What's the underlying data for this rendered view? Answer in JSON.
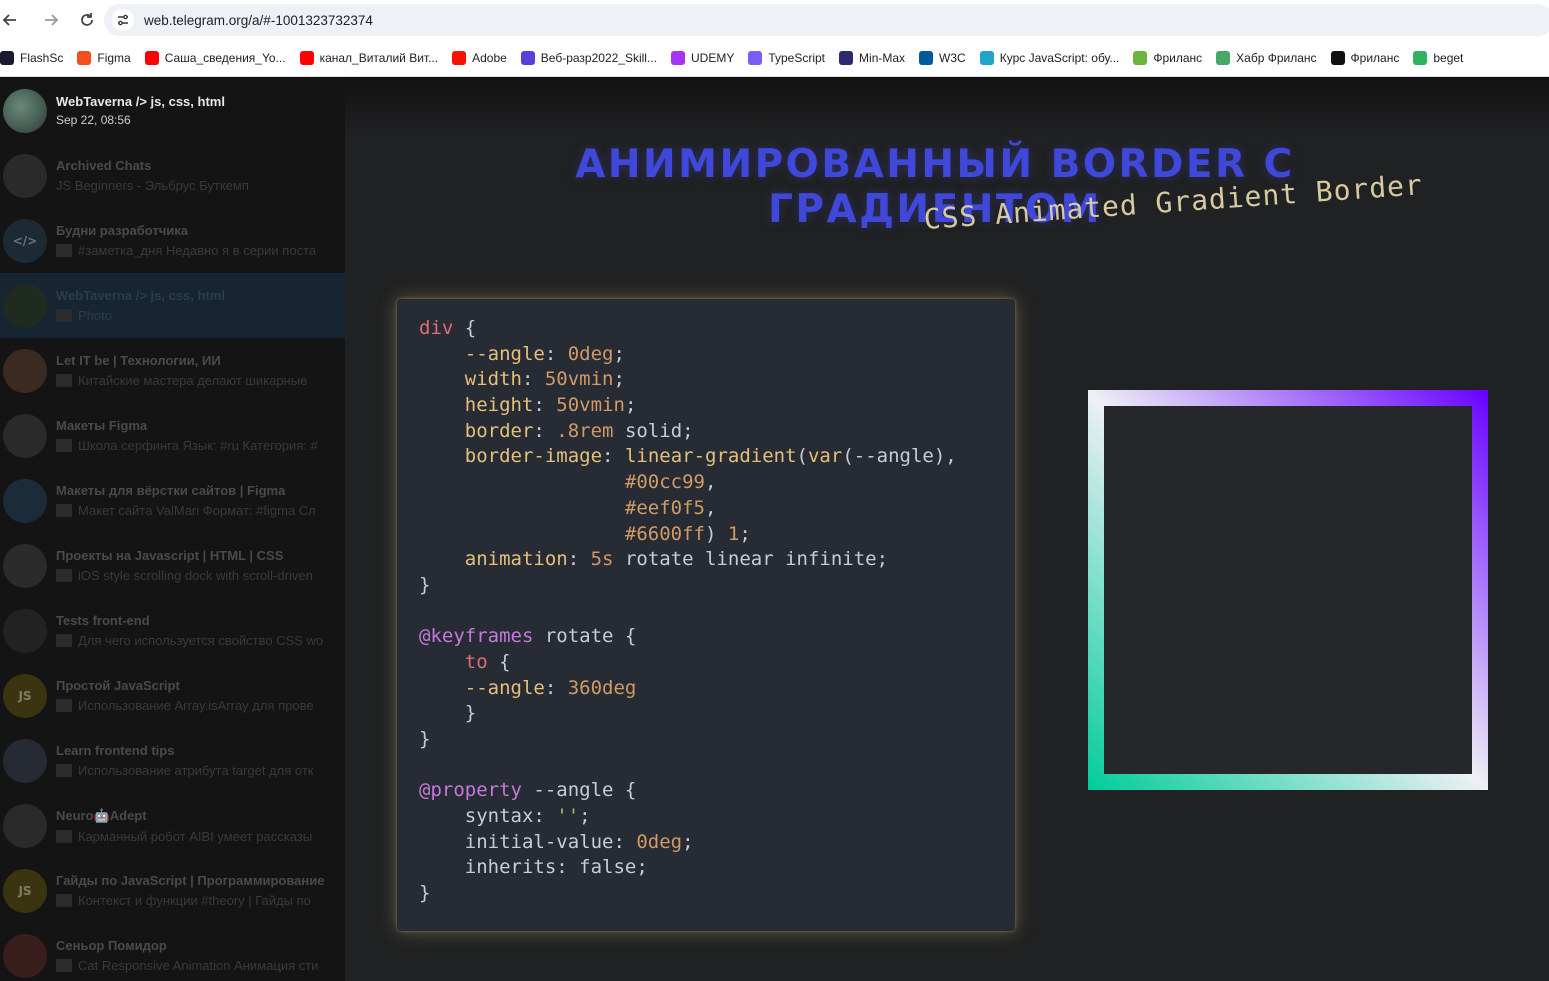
{
  "browser": {
    "url": "web.telegram.org/a/#-1001323732374"
  },
  "bookmarks": [
    {
      "label": "FlashSc",
      "icon": "flashcard-icon",
      "color": "#1a1a2e"
    },
    {
      "label": "Figma",
      "icon": "figma-icon",
      "color": "#f24e1e"
    },
    {
      "label": "Саша_сведения_Yo...",
      "icon": "youtube-icon",
      "color": "#ff0000"
    },
    {
      "label": "канал_Виталий Вит...",
      "icon": "youtube-icon",
      "color": "#ff0000"
    },
    {
      "label": "Adobe",
      "icon": "adobe-icon",
      "color": "#fa0f00"
    },
    {
      "label": "Веб-разр2022_Skill...",
      "icon": "skillbox-icon",
      "color": "#5b3fd9"
    },
    {
      "label": "UDEMY",
      "icon": "udemy-icon",
      "color": "#a435f0"
    },
    {
      "label": "TypeScript",
      "icon": "typescript-icon",
      "color": "#7b5cf5"
    },
    {
      "label": "Min-Max",
      "icon": "minmax-icon",
      "color": "#2d2a6e"
    },
    {
      "label": "W3C",
      "icon": "w3c-icon",
      "color": "#005a9c"
    },
    {
      "label": "Курс JavaScript: обу...",
      "icon": "course-icon",
      "color": "#1ea5c7"
    },
    {
      "label": "Фриланс",
      "icon": "freelance-icon",
      "color": "#6cb33f"
    },
    {
      "label": "Хабр Фриланс",
      "icon": "habr-icon",
      "color": "#48a868"
    },
    {
      "label": "Фриланс",
      "icon": "kwork-icon",
      "color": "#111111"
    },
    {
      "label": "beget",
      "icon": "beget-icon",
      "color": "#2fb35c"
    }
  ],
  "media_header": {
    "chat_name": "WebTaverna /> js, css, html",
    "date": "Sep 22, 08:56"
  },
  "chats": [
    {
      "name": "Archived Chats",
      "preview": "JS Beginners - Эльбрус Буткемп",
      "avatar_color": "#2a2a2a",
      "avatar_text": ""
    },
    {
      "name": "Будни разработчика",
      "preview": "#заметка_дня Недавно я в серии поста",
      "avatar_color": "#1c2a35",
      "avatar_text": "</>"
    },
    {
      "name": "WebTaverna /> js, css, html",
      "preview": "Photo",
      "avatar_color": "#1f2a20",
      "avatar_text": ""
    },
    {
      "name": "Let IT be | Технологии, ИИ",
      "preview": "Китайские мастера делают шикарные",
      "avatar_color": "#3a2a22",
      "avatar_text": ""
    },
    {
      "name": "Макеты Figma",
      "preview": "Школа серфинга Язык: #ru Категория: #",
      "avatar_color": "#2a2a2a",
      "avatar_text": ""
    },
    {
      "name": "Макеты для вёрстки сайтов | Figma",
      "preview": "Макет сайта ValMari Формат: #figma Сл",
      "avatar_color": "#1c2b3a",
      "avatar_text": ""
    },
    {
      "name": "Проекты на Javascript | HTML | CSS",
      "preview": "iOS style scrolling dock with scroll-driven",
      "avatar_color": "#2b2b2b",
      "avatar_text": ""
    },
    {
      "name": "Tests front-end",
      "preview": "Для чего используется свойство CSS wo",
      "avatar_color": "#222222",
      "avatar_text": ""
    },
    {
      "name": "Простой JavaScript",
      "preview": "Использование Array.isArray для прове",
      "avatar_color": "#3a3410",
      "avatar_text": "JS"
    },
    {
      "name": "Learn frontend tips",
      "preview": "Использование атрибута target для отк",
      "avatar_color": "#262a33",
      "avatar_text": ""
    },
    {
      "name": "Neuro🤖Adept",
      "preview": "Карманный робот AIBI умеет рассказы",
      "avatar_color": "#2a2a2a",
      "avatar_text": ""
    },
    {
      "name": "Гайды по JavaScript | Программирование",
      "preview": "Контекст и функции #theory | Гайды по",
      "avatar_color": "#3a3510",
      "avatar_text": "JS"
    },
    {
      "name": "Сеньор Помидор",
      "preview": "Cat Responsive Animation Анимация сти",
      "avatar_color": "#3a1e1e",
      "avatar_text": ""
    }
  ],
  "slide": {
    "title": "АНИМИРОВАННЫЙ BORDER С ГРАДИЕНТОМ",
    "subtitle": "CSS Animated Gradient Border",
    "code_lines": [
      [
        [
          "sel",
          "div"
        ],
        [
          "plain",
          " {"
        ]
      ],
      [
        [
          "plain",
          "    "
        ],
        [
          "prop",
          "--angle"
        ],
        [
          "plain",
          ": "
        ],
        [
          "num",
          "0deg"
        ],
        [
          "plain",
          ";"
        ]
      ],
      [
        [
          "plain",
          "    "
        ],
        [
          "prop",
          "width"
        ],
        [
          "plain",
          ": "
        ],
        [
          "num",
          "50vmin"
        ],
        [
          "plain",
          ";"
        ]
      ],
      [
        [
          "plain",
          "    "
        ],
        [
          "prop",
          "height"
        ],
        [
          "plain",
          ": "
        ],
        [
          "num",
          "50vmin"
        ],
        [
          "plain",
          ";"
        ]
      ],
      [
        [
          "plain",
          "    "
        ],
        [
          "prop",
          "border"
        ],
        [
          "plain",
          ": "
        ],
        [
          "num",
          ".8rem"
        ],
        [
          "plain",
          " solid;"
        ]
      ],
      [
        [
          "plain",
          "    "
        ],
        [
          "prop",
          "border-image"
        ],
        [
          "plain",
          ": "
        ],
        [
          "fn",
          "linear-gradient"
        ],
        [
          "plain",
          "("
        ],
        [
          "fn",
          "var"
        ],
        [
          "plain",
          "(--angle),"
        ]
      ],
      [
        [
          "plain",
          "                  "
        ],
        [
          "num",
          "#00cc99"
        ],
        [
          "plain",
          ","
        ]
      ],
      [
        [
          "plain",
          "                  "
        ],
        [
          "num",
          "#eef0f5"
        ],
        [
          "plain",
          ","
        ]
      ],
      [
        [
          "plain",
          "                  "
        ],
        [
          "num",
          "#6600ff"
        ],
        [
          "plain",
          ") "
        ],
        [
          "num",
          "1"
        ],
        [
          "plain",
          ";"
        ]
      ],
      [
        [
          "plain",
          "    "
        ],
        [
          "prop",
          "animation"
        ],
        [
          "plain",
          ": "
        ],
        [
          "num",
          "5s"
        ],
        [
          "plain",
          " rotate linear infinite;"
        ]
      ],
      [
        [
          "plain",
          "}"
        ]
      ],
      [
        [
          "plain",
          ""
        ]
      ],
      [
        [
          "at",
          "@keyframes"
        ],
        [
          "plain",
          " rotate {"
        ]
      ],
      [
        [
          "plain",
          "    "
        ],
        [
          "sel",
          "to"
        ],
        [
          "plain",
          " {"
        ]
      ],
      [
        [
          "plain",
          "    "
        ],
        [
          "prop",
          "--angle"
        ],
        [
          "plain",
          ": "
        ],
        [
          "num",
          "360deg"
        ]
      ],
      [
        [
          "plain",
          "    }"
        ]
      ],
      [
        [
          "plain",
          "}"
        ]
      ],
      [
        [
          "plain",
          ""
        ]
      ],
      [
        [
          "at",
          "@property"
        ],
        [
          "plain",
          " --angle {"
        ]
      ],
      [
        [
          "plain",
          "    syntax: "
        ],
        [
          "green",
          "''"
        ],
        [
          "plain",
          ";"
        ]
      ],
      [
        [
          "plain",
          "    initial-value: "
        ],
        [
          "num",
          "0deg"
        ],
        [
          "plain",
          ";"
        ]
      ],
      [
        [
          "plain",
          "    inherits: false;"
        ]
      ],
      [
        [
          "plain",
          "}"
        ]
      ]
    ]
  },
  "colors": {
    "title_blue": "#3f48d8",
    "gradient_start": "#00cc99",
    "gradient_mid": "#eef0f5",
    "gradient_end": "#6600ff"
  }
}
